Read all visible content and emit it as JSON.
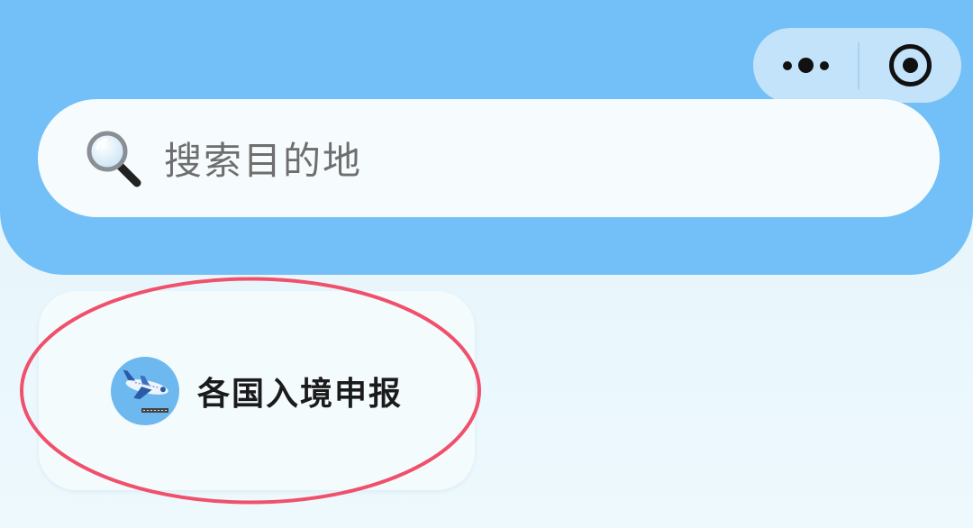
{
  "header": {
    "more_icon": "more-dots-icon",
    "close_icon": "target-circle-icon"
  },
  "search": {
    "icon": "magnifier-icon",
    "placeholder": "搜索目的地"
  },
  "entry": {
    "icon": "airplane-arrival-icon",
    "label": "各国入境申报"
  },
  "annotation": {
    "color": "#f0506b"
  },
  "colors": {
    "header_bg": "#72c0f7",
    "page_bg": "#e6f5fc",
    "card_bg": "#f4fbfd"
  }
}
